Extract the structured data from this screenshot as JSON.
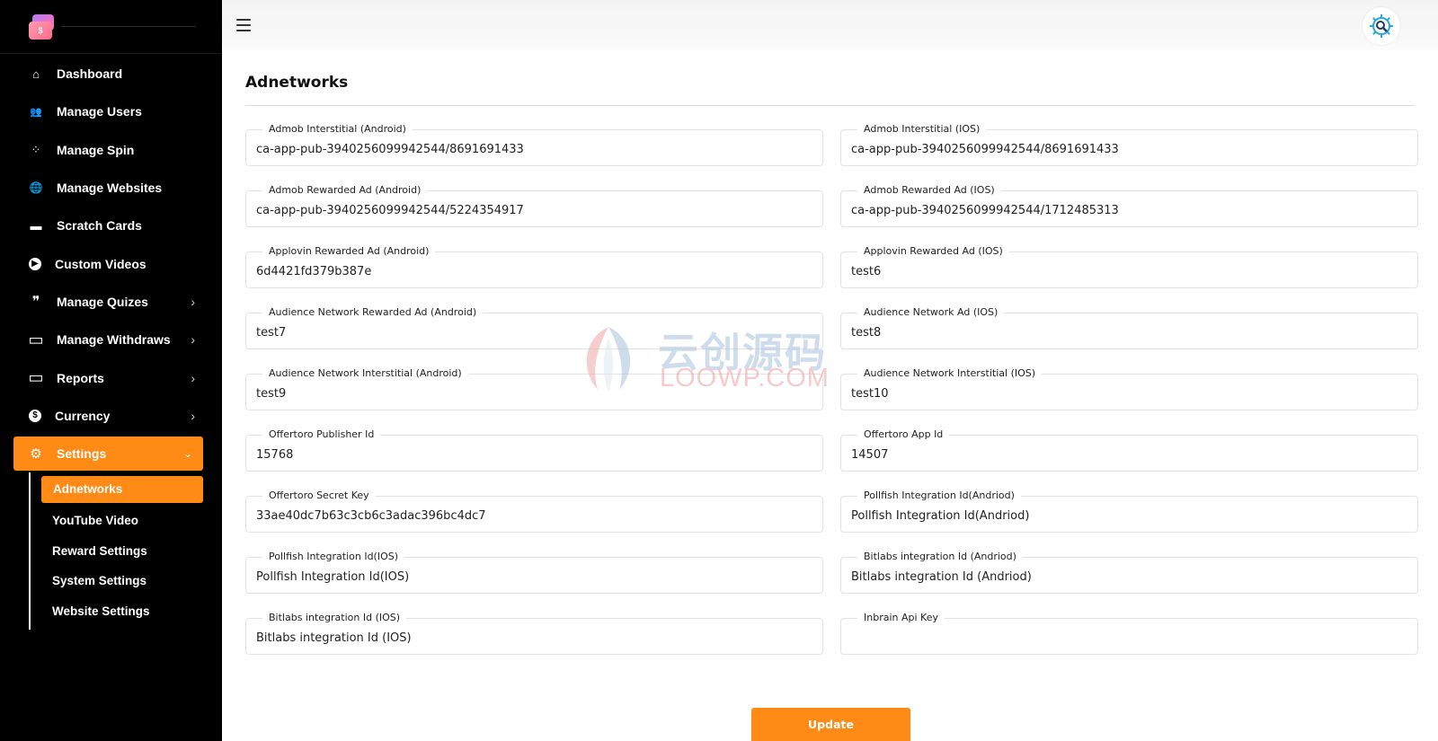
{
  "sidebar": {
    "items": [
      {
        "label": "Dashboard",
        "icon": "home-icon",
        "glyph": "⌂"
      },
      {
        "label": "Manage Users",
        "icon": "users-icon",
        "glyph": "👥"
      },
      {
        "label": "Manage Spin",
        "icon": "spinner-icon",
        "glyph": "⁘"
      },
      {
        "label": "Manage Websites",
        "icon": "globe-icon",
        "glyph": "🌐"
      },
      {
        "label": "Scratch Cards",
        "icon": "ticket-icon",
        "glyph": "▬"
      },
      {
        "label": "Custom Videos",
        "icon": "play-circle-icon",
        "glyph": "▶"
      },
      {
        "label": "Manage Quizes",
        "icon": "quote-icon",
        "glyph": "❞",
        "chevron": "›"
      },
      {
        "label": "Manage Withdraws",
        "icon": "credit-card-icon",
        "glyph": "▭",
        "chevron": "›"
      },
      {
        "label": "Reports",
        "icon": "credit-card-icon",
        "glyph": "▭",
        "chevron": "›"
      },
      {
        "label": "Currency",
        "icon": "dollar-circle-icon",
        "glyph": "$",
        "chevron": "›"
      },
      {
        "label": "Settings",
        "icon": "cogs-icon",
        "glyph": "⚙",
        "chevron": "⌄"
      }
    ],
    "submenu": [
      "Adnetworks",
      "YouTube Video",
      "Reward Settings",
      "System Settings",
      "Website Settings"
    ]
  },
  "main": {
    "title": "Adnetworks",
    "fields": [
      {
        "label": "Admob Interstitial (Android)",
        "value": "ca-app-pub-3940256099942544/8691691433"
      },
      {
        "label": "Admob Interstitial (IOS)",
        "value": "ca-app-pub-3940256099942544/8691691433"
      },
      {
        "label": "Admob Rewarded Ad (Android)",
        "value": "ca-app-pub-3940256099942544/5224354917"
      },
      {
        "label": "Admob Rewarded Ad (IOS)",
        "value": "ca-app-pub-3940256099942544/1712485313"
      },
      {
        "label": "Applovin Rewarded Ad (Android)",
        "value": "6d4421fd379b387e"
      },
      {
        "label": "Applovin Rewarded Ad (IOS)",
        "value": "test6"
      },
      {
        "label": "Audience Network Rewarded Ad (Android)",
        "value": "test7"
      },
      {
        "label": "Audience Network Ad (IOS)",
        "value": "test8"
      },
      {
        "label": "Audience Network Interstitial (Android)",
        "value": "test9"
      },
      {
        "label": "Audience Network Interstitial (IOS)",
        "value": "test10"
      },
      {
        "label": "Offertoro Publisher Id",
        "value": "15768"
      },
      {
        "label": "Offertoro App Id",
        "value": "14507"
      },
      {
        "label": "Offertoro Secret Key",
        "value": "33ae40dc7b63c3cb6c3adac396bc4dc7"
      },
      {
        "label": "Pollfish Integration Id(Andriod)",
        "value": "Pollfish Integration Id(Andriod)"
      },
      {
        "label": "Pollfish Integration Id(IOS)",
        "value": "Pollfish Integration Id(IOS)"
      },
      {
        "label": "Bitlabs integration Id (Andriod)",
        "value": "Bitlabs integration Id (Andriod)"
      },
      {
        "label": "Bitlabs integration Id (IOS)",
        "value": "Bitlabs integration Id (IOS)"
      },
      {
        "label": "Inbrain Api Key",
        "value": ""
      }
    ],
    "update_label": "Update"
  },
  "watermark": {
    "cn": "云创源码",
    "en": "LOOWP.COM"
  },
  "colors": {
    "accent": "#ff8b16",
    "sidebar_bg": "#000000"
  }
}
